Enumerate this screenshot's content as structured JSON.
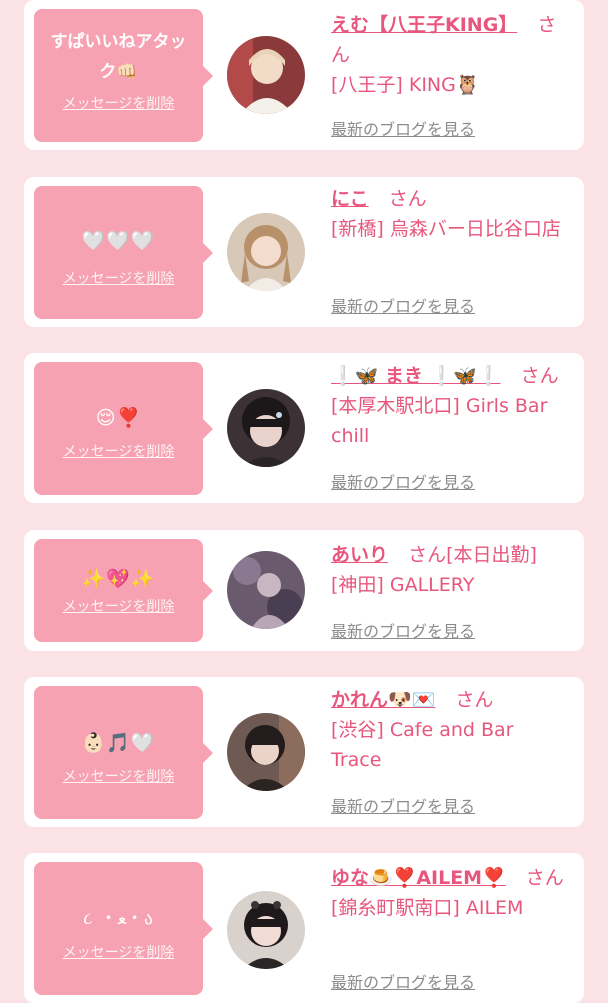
{
  "messages": [
    {
      "message": "すぱいいねアタック👊🏻",
      "delete_label": "メッセージを削除",
      "name": "えむ【八王子KING】",
      "honorific": "さん",
      "shop": "[八王子] KING🦉",
      "blog_label": "最新のブログを見る",
      "avatar_colors": [
        "#8a3a3a",
        "#e8d2b8",
        "#f2dcc8"
      ]
    },
    {
      "message": "🤍🤍🤍",
      "delete_label": "メッセージを削除",
      "name": "にこ",
      "honorific": "さん",
      "shop": "[新橋] 烏森バー日比谷口店",
      "blog_label": "最新のブログを見る",
      "avatar_colors": [
        "#d8c8b8",
        "#b8906a",
        "#f3dccd"
      ]
    },
    {
      "message": "😌❣️",
      "delete_label": "メッセージを削除",
      "name": "❕🦋 まき ❕🦋❕",
      "honorific": "さん",
      "shop": "[本厚木駅北口] Girls Bar chill",
      "blog_label": "最新のブログを見る",
      "avatar_colors": [
        "#3c3236",
        "#1c181a",
        "#e9d2cc"
      ]
    },
    {
      "message": "✨💖✨",
      "delete_label": "メッセージを削除",
      "name": "あいり",
      "honorific": "さん[本日出勤]",
      "shop": "[神田] GALLERY",
      "blog_label": "最新のブログを見る",
      "avatar_colors": [
        "#6a5a6e",
        "#4a3e52",
        "#c8b6c2"
      ]
    },
    {
      "message": "👶🏻🎵🤍",
      "delete_label": "メッセージを削除",
      "name": "かれん🐶💌",
      "honorific": "さん",
      "shop": "[渋谷] Cafe and Bar Trace",
      "blog_label": "最新のブログを見る",
      "avatar_colors": [
        "#6e5a52",
        "#231c1c",
        "#ecd3c8"
      ]
    },
    {
      "message": "૮ ・ﻌ・ა",
      "delete_label": "メッセージを削除",
      "name": "ゆな🍮❣️AILEM❣️",
      "honorific": "さん",
      "shop": "[錦糸町駅南口] AILEM",
      "blog_label": "最新のブログを見る",
      "avatar_colors": [
        "#d9d2cc",
        "#1e1a1c",
        "#f0dcd4"
      ]
    }
  ]
}
